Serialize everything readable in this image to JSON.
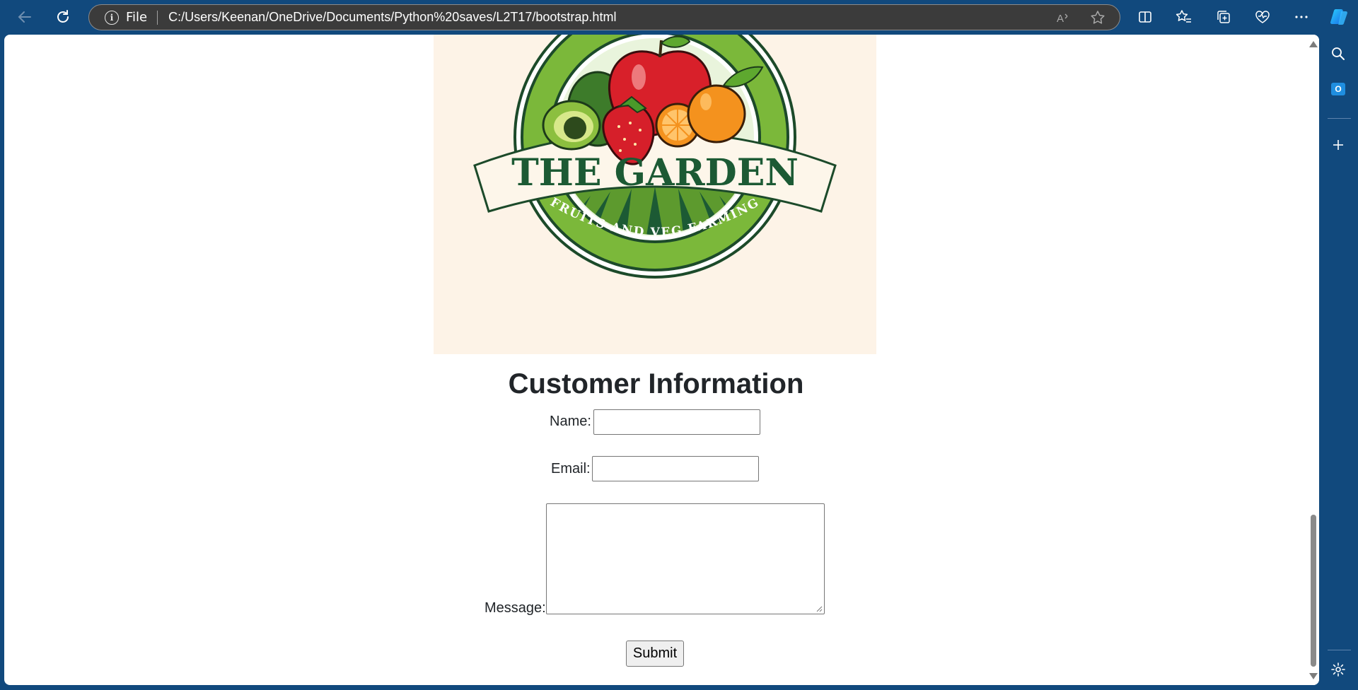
{
  "browser": {
    "scheme_label": "File",
    "url": "C:/Users/Keenan/OneDrive/Documents/Python%20saves/L2T17/bootstrap.html",
    "icons": {
      "back": "back-arrow-icon",
      "refresh": "refresh-icon",
      "info": "info-icon",
      "read_aloud": "read-aloud-icon",
      "favorite": "star-icon",
      "split_screen": "split-screen-icon",
      "favorites": "favorites-icon",
      "collections": "collections-icon",
      "browser_essentials": "heart-pulse-icon",
      "more": "more-icon",
      "copilot": "copilot-icon"
    }
  },
  "sidebar": {
    "icons": [
      "search-icon",
      "outlook-icon",
      "add-icon",
      "settings-icon"
    ],
    "outlook_letter": "O"
  },
  "logo": {
    "title": "THE GARDEN",
    "subtitle": "FRUITS AND VEG FARMING",
    "colors": {
      "background": "#fdf3e7",
      "ring_green": "#7bb83a",
      "dark_green": "#1c5a34",
      "apple_red": "#d8202a",
      "orange": "#f4921e"
    }
  },
  "form": {
    "title": "Customer Information",
    "name_label": "Name:",
    "name_value": "",
    "email_label": "Email:",
    "email_value": "",
    "message_label": "Message:",
    "message_value": "",
    "submit_label": "Submit"
  },
  "scrollbar": {
    "position_fraction": 0.86
  }
}
